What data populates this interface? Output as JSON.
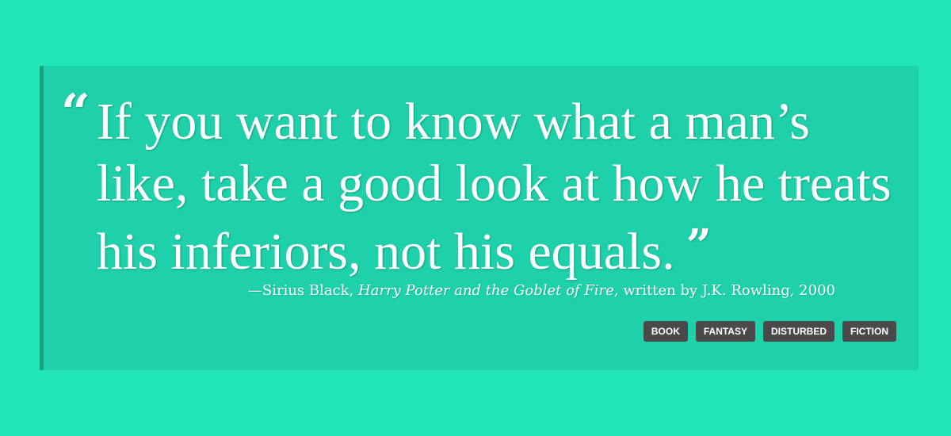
{
  "quote": {
    "open_mark": "“",
    "text": "If you want to know what a man’s like, take a good look at how he treats his inferiors, not his equals.",
    "close_mark": "”"
  },
  "attribution": {
    "prefix": "—Sirius Black, ",
    "work": "Harry Potter and the Goblet of Fire",
    "suffix": ", written by J.K. Rowling, 2000"
  },
  "tags": [
    "BOOK",
    "FANTASY",
    "DISTURBED",
    "FICTION"
  ],
  "colors": {
    "page_background": "#22e6b8",
    "card_background": "#1fd1aa",
    "card_border": "#17a383",
    "tag_background": "#4a4a4a",
    "text": "#ffffff"
  }
}
